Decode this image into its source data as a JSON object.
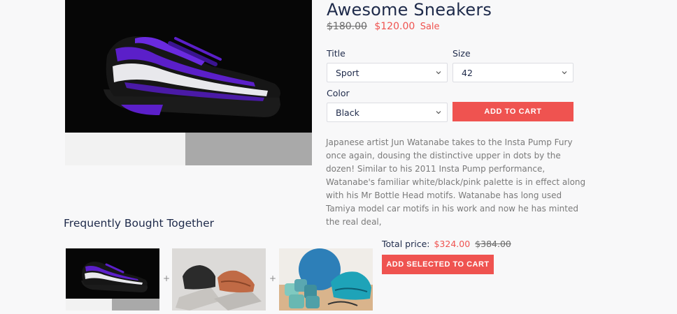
{
  "product": {
    "title": "Awesome Sneakers",
    "price_old": "$180.00",
    "price_new": "$120.00",
    "sale_label": "Sale",
    "image_icon": "sneaker-image"
  },
  "options": {
    "title_label": "Title",
    "title_value": "Sport",
    "size_label": "Size",
    "size_value": "42",
    "color_label": "Color",
    "color_value": "Black"
  },
  "cart": {
    "add_label": "ADD TO CART"
  },
  "description": "Japanese artist Jun Watanabe takes to the Insta Pump Fury once again, dousing the distinctive upper in dots by the dozen! Similar to his 2011 Insta Pump performance, Watanabe's familiar white/black/pink palette is in effect along with his Mr Bottle Head motifs. Watanabe has long used Tamiya model car motifs in his work and now he has minted the real deal,",
  "fbt": {
    "title": "Frequently Bought Together",
    "plus": "+",
    "total_label": "Total price:",
    "total_new": "$324.00",
    "total_old": "$384.00",
    "add_selected_label": "ADD SELECTED TO CART"
  },
  "colors": {
    "accent": "#ef5350",
    "heading": "#1e2a4a",
    "shoe_purple": "#5b1fc9"
  }
}
